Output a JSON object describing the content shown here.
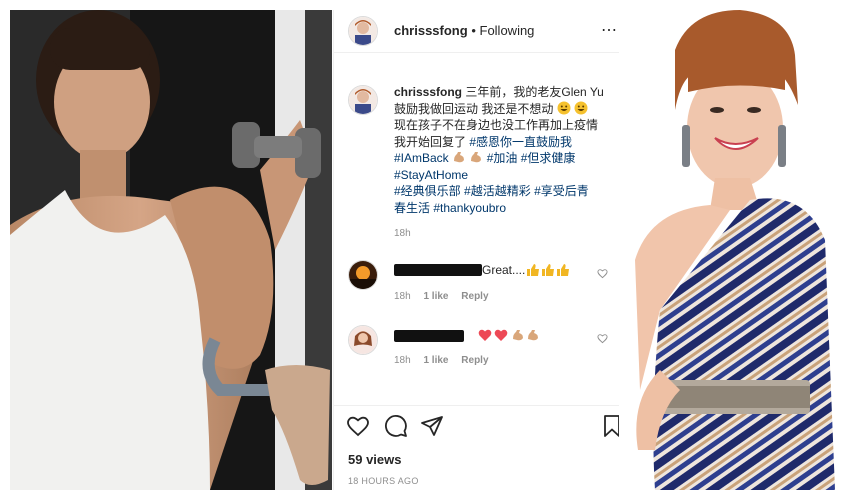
{
  "post": {
    "username": "chrisssfong",
    "separator": "•",
    "follow_state": "Following",
    "caption": {
      "line1": "三年前，我的老友Glen Yu",
      "line2": "鼓励我做回运动 我还是不想动",
      "line3": "现在孩子不在身边也没工作再加上疫情",
      "line4": "我开始回复了",
      "tag1": "#感恩你一直鼓励我",
      "tag2": "#IAmBack",
      "tag3": "#加油",
      "tag4": "#但求健康",
      "tag5": "#StayAtHome",
      "tag6": "#经典俱乐部",
      "tag7": "#越活越精彩",
      "tag8": "#享受后青",
      "tag8b": "春生活",
      "tag9": "#thankyoubro"
    },
    "caption_time": "18h",
    "views": "59 views",
    "posted_ago": "18 HOURS AGO"
  },
  "comments": [
    {
      "text": "Great....",
      "time": "18h",
      "likes": "1 like",
      "reply": "Reply"
    },
    {
      "text": "",
      "time": "18h",
      "likes": "1 like",
      "reply": "Reply"
    }
  ],
  "icons": [
    "heart-icon",
    "comment-icon",
    "share-icon",
    "bookmark-icon",
    "more-options-icon"
  ],
  "colors": {
    "hashtag": "#00376b",
    "muted": "#8e8e8e",
    "heart_red": "#ed4956",
    "stripe_navy": "#1f2a6b"
  }
}
